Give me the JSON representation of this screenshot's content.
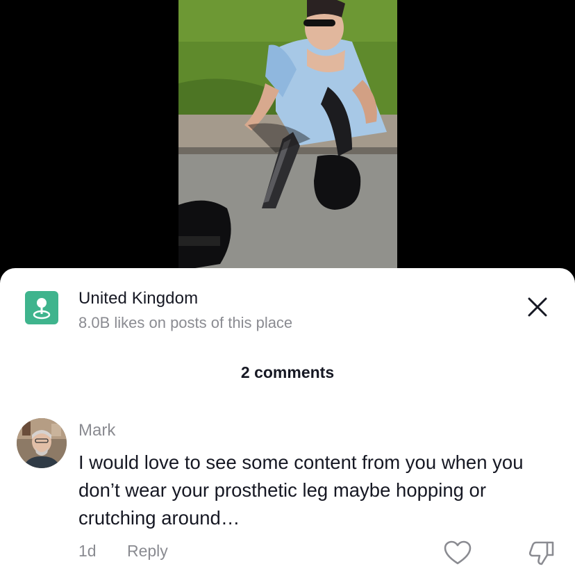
{
  "location": {
    "name": "United Kingdom",
    "stats": "8.0B likes on posts of this place",
    "icon": "location-pin-icon",
    "icon_color": "#3fb48d"
  },
  "comments_header": {
    "count_label": "2 comments"
  },
  "comments": [
    {
      "author": "Mark",
      "text": "I would love to see some content from you when you don’t wear your prosthetic leg maybe hopping or crutching around…",
      "time": "1d",
      "reply_label": "Reply"
    }
  ],
  "colors": {
    "primary_text": "#161823",
    "secondary_text": "#8a8b91",
    "sheet_background": "#ffffff",
    "backdrop": "#000000"
  }
}
